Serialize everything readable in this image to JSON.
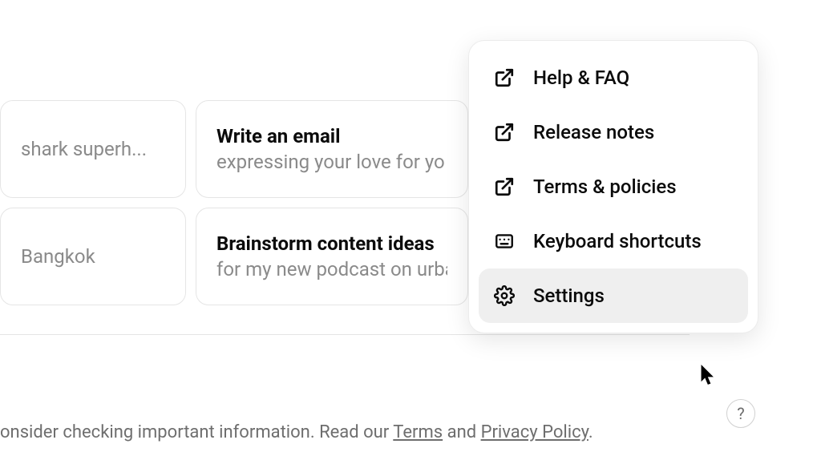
{
  "suggestions": [
    {
      "title": "",
      "sub": "shark superh..."
    },
    {
      "title": "Write an email",
      "sub": "expressing your love for yo"
    },
    {
      "title": "",
      "sub": "Bangkok"
    },
    {
      "title": "Brainstorm content ideas",
      "sub": "for my new podcast on urba"
    }
  ],
  "menu": {
    "items": [
      {
        "label": "Help & FAQ",
        "icon": "external"
      },
      {
        "label": "Release notes",
        "icon": "external"
      },
      {
        "label": "Terms & policies",
        "icon": "external"
      },
      {
        "label": "Keyboard shortcuts",
        "icon": "keyboard"
      },
      {
        "label": "Settings",
        "icon": "gear"
      }
    ]
  },
  "footer": {
    "prefix": "onsider checking important information. Read our ",
    "terms_label": "Terms",
    "and": " and ",
    "privacy_label": "Privacy Policy",
    "suffix": "."
  },
  "help_button": "?"
}
